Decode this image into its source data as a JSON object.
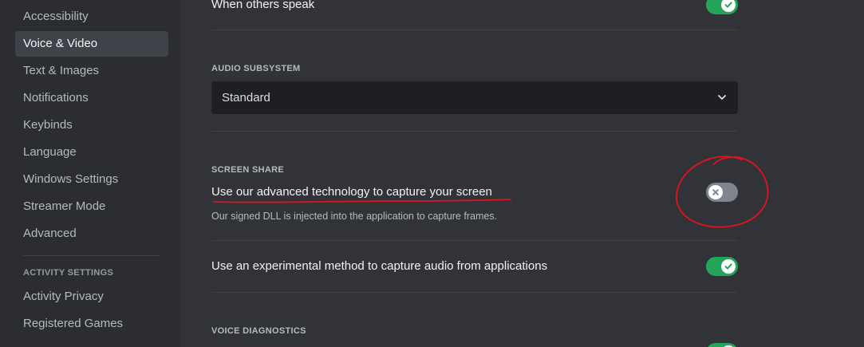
{
  "sidebar": {
    "items": [
      {
        "label": "Accessibility"
      },
      {
        "label": "Voice & Video",
        "selected": true
      },
      {
        "label": "Text & Images"
      },
      {
        "label": "Notifications"
      },
      {
        "label": "Keybinds"
      },
      {
        "label": "Language"
      },
      {
        "label": "Windows Settings"
      },
      {
        "label": "Streamer Mode"
      },
      {
        "label": "Advanced"
      }
    ],
    "activity_header": "ACTIVITY SETTINGS",
    "activity_items": [
      {
        "label": "Activity Privacy"
      },
      {
        "label": "Registered Games"
      }
    ]
  },
  "main": {
    "when_others_speak": {
      "label": "When others speak",
      "enabled": true
    },
    "audio_subsystem": {
      "header": "AUDIO SUBSYSTEM",
      "value": "Standard"
    },
    "screen_share": {
      "header": "SCREEN SHARE",
      "title": "Use our advanced technology to capture your screen",
      "description": "Our signed DLL is injected into the application to capture frames.",
      "enabled": false
    },
    "experimental_audio": {
      "label": "Use an experimental method to capture audio from applications",
      "enabled": true
    },
    "voice_diagnostics": {
      "header": "VOICE DIAGNOSTICS",
      "enabled": true
    }
  },
  "colors": {
    "toggle_on": "#23a55a",
    "toggle_off": "#80848e",
    "annotation": "#e0141e"
  }
}
